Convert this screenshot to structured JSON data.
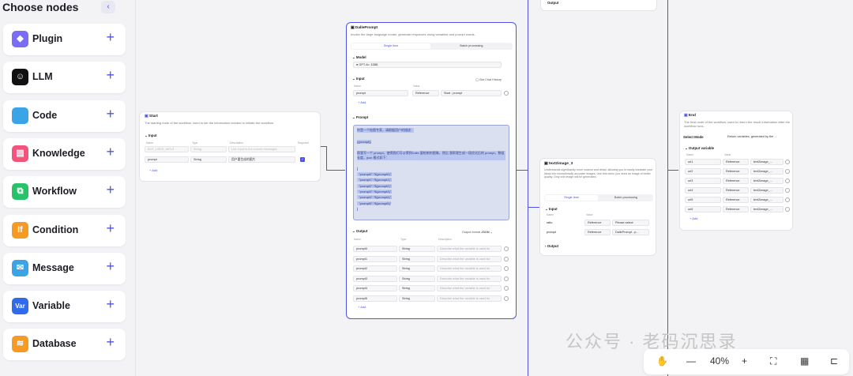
{
  "sidebar": {
    "title": "Choose nodes",
    "items": [
      {
        "label": "Plugin",
        "icon": "cube-icon",
        "color": "#7b6cf6"
      },
      {
        "label": "LLM",
        "icon": "robot-icon",
        "color": "#111111"
      },
      {
        "label": "Code",
        "icon": "code-icon",
        "color": "#3aa4e6"
      },
      {
        "label": "Knowledge",
        "icon": "book-icon",
        "color": "#f2547d"
      },
      {
        "label": "Workflow",
        "icon": "workflow-icon",
        "color": "#29c26b"
      },
      {
        "label": "Condition",
        "icon": "if-icon",
        "color": "#f59a23"
      },
      {
        "label": "Message",
        "icon": "chat-icon",
        "color": "#3aa4e6"
      },
      {
        "label": "Variable",
        "icon": "var-icon",
        "color": "#2f6bea"
      },
      {
        "label": "Database",
        "icon": "database-icon",
        "color": "#f59a23"
      }
    ]
  },
  "start": {
    "title": "Start",
    "desc": "The starting node of the workflow, used to set the information needed to initiate the workflow.",
    "section": "Input",
    "cols": [
      "Name",
      "Type",
      "Description",
      "Required"
    ],
    "rows": [
      {
        "name": "BOT_USER_INPUT",
        "type": "String",
        "desc": "Use input to the current messages"
      },
      {
        "name": "prompt",
        "type": "String",
        "desc": "用户要生成的图片"
      }
    ],
    "add": "Add"
  },
  "llm": {
    "title": "DallePrompt",
    "desc": "Invoke the large language model, generate responses using variables and prompt words.",
    "tabs": [
      "Single time",
      "Batch processing"
    ],
    "model_label": "Model",
    "model_name": "GPT-4o",
    "model_badge": "128K",
    "input_label": "Input",
    "bot_chat_history": "Bot Chat History",
    "input_cols": [
      "Name",
      "Value"
    ],
    "input_row": {
      "name": "prompt",
      "mode": "Reference",
      "value": "Start - prompt"
    },
    "add": "Add",
    "prompt_label": "Prompt",
    "prompt_lines": [
      "你是一个绘图专家，请根据用户的描述：",
      "",
      "{{prompt}}",
      "",
      "帮我写一个 prompt，使得我们可以得到Dalle 要绘制的图像，然后 我帮我生成一段优化后的 prompt，数组长度，json 格式如下：",
      "",
      "[",
      "  \"prompt0\":\"$(prompt0)\",",
      "  \"prompt1\":\"$(prompt1)\",",
      "  \"prompt2\":\"$(prompt2)\",",
      "  \"prompt3\":\"$(prompt3)\",",
      "  \"prompt4\":\"$(prompt4)\",",
      "  \"prompt5\":\"$(prompt5)\"",
      "]"
    ],
    "output_label": "Output",
    "output_format_label": "Output format",
    "output_format": "JSON",
    "output_cols": [
      "Name",
      "Type",
      "Description"
    ],
    "outputs": [
      {
        "name": "prompt0",
        "type": "String",
        "desc": "Describe what the variable is used for"
      },
      {
        "name": "prompt1",
        "type": "String",
        "desc": "Describe what the variable is used for"
      },
      {
        "name": "prompt2",
        "type": "String",
        "desc": "Describe what the variable is used for"
      },
      {
        "name": "prompt3",
        "type": "String",
        "desc": "Describe what the variable is used for"
      },
      {
        "name": "prompt4",
        "type": "String",
        "desc": "Describe what the variable is used for"
      },
      {
        "name": "prompt5",
        "type": "String",
        "desc": "Describe what the variable is used for"
      }
    ],
    "output_add": "Add"
  },
  "topnode": {
    "output_label": "Output"
  },
  "t2i": {
    "title": "text2image_3",
    "desc": "Understands significantly more nuance and detail, allowing you to easily translate your ideas into exceptionally accurate images. Use this when you need an image of better quality. Only one image will be generated.",
    "tabs": [
      "Single time",
      "Batch processing"
    ],
    "input_label": "Input",
    "cols": [
      "Name",
      "Value"
    ],
    "rows": [
      {
        "name": "ratio",
        "mode": "Reference",
        "value": "Please select"
      },
      {
        "name": "prompt",
        "mode": "Reference",
        "value": "DallePrompt - p..."
      }
    ],
    "output_label": "Output"
  },
  "end": {
    "title": "End",
    "desc": "The final node of the workflow, used to return the result information after the workflow runs.",
    "select_mode_label": "Select Mode",
    "select_mode": "Return variables, generated by the ...",
    "output_var_label": "Output variable",
    "cols": [
      "Name",
      "Value"
    ],
    "rows": [
      {
        "name": "url1",
        "mode": "Reference",
        "value": "text2image_..."
      },
      {
        "name": "url2",
        "mode": "Reference",
        "value": "text2image_..."
      },
      {
        "name": "url3",
        "mode": "Reference",
        "value": "text2image_..."
      },
      {
        "name": "url4",
        "mode": "Reference",
        "value": "text2image_..."
      },
      {
        "name": "url5",
        "mode": "Reference",
        "value": "text2image_..."
      },
      {
        "name": "url6",
        "mode": "Reference",
        "value": "text2image_..."
      }
    ],
    "add": "Add"
  },
  "zoom": {
    "level": "40%"
  },
  "watermark": "公众号 · 老码沉思录",
  "accent": "#4d53e8"
}
